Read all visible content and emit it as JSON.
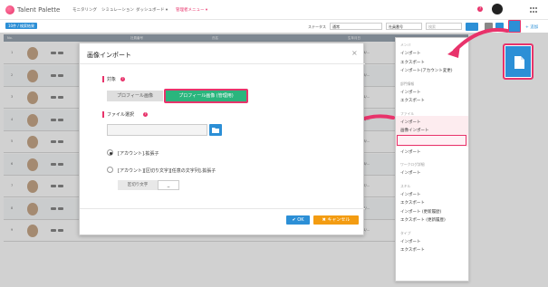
{
  "app": {
    "logo_text": "Talent Palette",
    "nav": [
      "モニタリング",
      "シミュレーション",
      "ダッシュボード ▾",
      "管理者メニュー ▾"
    ],
    "active_nav_index": 3
  },
  "subbar": {
    "tag": "10件 / 検索結果",
    "status_label": "ステータス",
    "status_value": "通常",
    "sort_value": "社員番号",
    "search_placeholder": "検索",
    "add_label": "+ 追加"
  },
  "table": {
    "headers": [
      "No.",
      "社員番号",
      "氏名",
      "生年月日"
    ],
    "rows": [
      {
        "no": "1",
        "date": "1970/04/..."
      },
      {
        "no": "2",
        "date": "1991/05/..."
      },
      {
        "no": "3",
        "date": "1991/01/..."
      },
      {
        "no": "4",
        "date": "1991/02/..."
      },
      {
        "no": "5",
        "date": "1991/03/..."
      },
      {
        "no": "6",
        "date": "1991/06/..."
      },
      {
        "no": "7",
        "date": "1991/07/..."
      },
      {
        "no": "8",
        "date": "1991/01/..."
      },
      {
        "no": "9",
        "date": "1991/01/..."
      }
    ]
  },
  "modal": {
    "title": "画像インポート",
    "target_label": "対象",
    "btn_profile": "プロフィール画像",
    "btn_profile_admin": "プロフィール画像 (管理用)",
    "file_label": "ファイル選択",
    "radio1": "[アカウント].拡張子",
    "radio2": "[アカウント][区切り文字][任意の文字列].拡張子",
    "separator_label": "区切り文字",
    "separator_value": "_",
    "ok_label": "✔ OK",
    "cancel_label": "✖ キャンセル"
  },
  "dropdown": {
    "sections": [
      {
        "head": "メンバ",
        "items": [
          "インポート",
          "エクスポート",
          "インポート(アカウント変更)"
        ]
      },
      {
        "head": "部門情報",
        "items": [
          "インポート",
          "エクスポート"
        ]
      },
      {
        "head": "ファイル",
        "items": [
          "インポート",
          "画像インポート"
        ]
      },
      {
        "head": "ワークログ",
        "items": [
          "インポート"
        ]
      },
      {
        "head": "ワークログ詳細",
        "items": [
          "インポート"
        ]
      },
      {
        "head": "スキル",
        "items": [
          "インポート",
          "エクスポート",
          "インポート (更新履歴)",
          "エクスポート (更新履歴)"
        ]
      },
      {
        "head": "タイプ",
        "items": [
          "インポート",
          "エクスポート"
        ]
      }
    ]
  },
  "colors": {
    "accent_pink": "#e8336b",
    "primary_blue": "#2c8fd6",
    "green": "#2ab57d",
    "orange": "#f39c12"
  }
}
